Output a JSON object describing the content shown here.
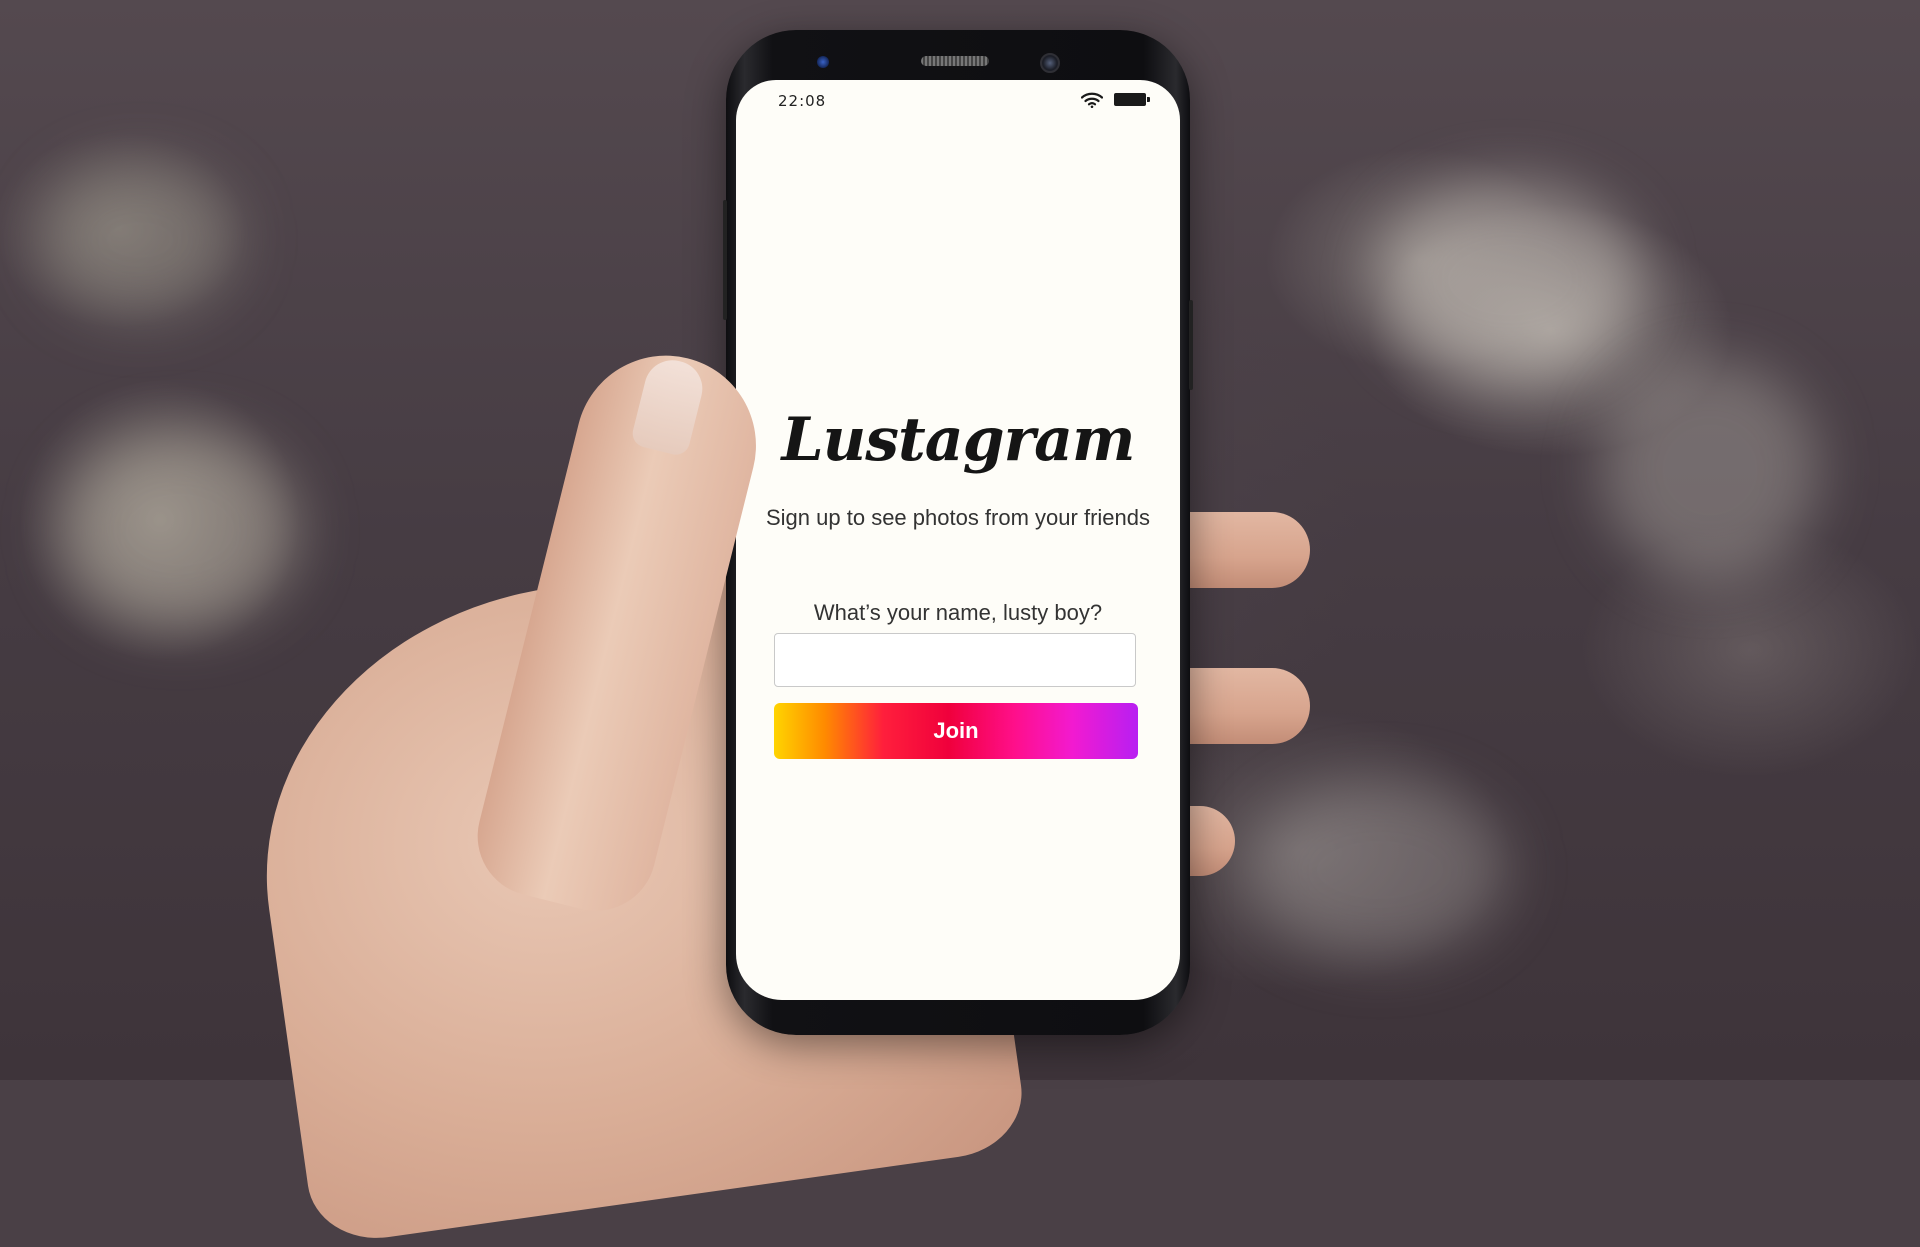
{
  "status_bar": {
    "time": "22:08",
    "wifi_icon": "wifi-icon",
    "battery_icon": "battery-full-icon"
  },
  "app": {
    "logo_text": "Lustagram",
    "tagline": "Sign up to see photos from your friends",
    "name_prompt": "What’s your name, lusty boy?",
    "name_input_value": "",
    "join_label": "Join"
  },
  "colors": {
    "screen_background": "#fefdf8",
    "join_gradient": [
      "#ffd400",
      "#ff1f3c",
      "#ff0f8a",
      "#b81ff2"
    ],
    "text": "#333333"
  }
}
